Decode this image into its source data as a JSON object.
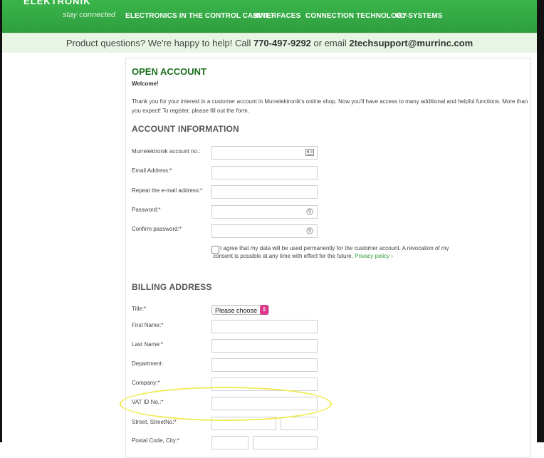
{
  "brand": {
    "name": "ELEKTRONIK",
    "tagline": "stay connected"
  },
  "nav": [
    "ELECTRONICS IN THE CONTROL CABINET",
    "INTERFACES",
    "CONNECTION TECHNOLOGY",
    "I/O-SYSTEMS"
  ],
  "hotline": {
    "prefix": "Product questions? We're happy to help! Call ",
    "phone": "770-497-9292",
    "mid": " or email ",
    "email": "2techsupport@murrinc.com"
  },
  "form": {
    "title": "OPEN ACCOUNT",
    "welcome": "Welcome!",
    "intro": "Thank you for your interest in a customer account in Murrelektronik's online shop. Now you'll have access to many additional and helpful functions. More than you expect! To register, please fill out the form.",
    "account_section": "ACCOUNT INFORMATION",
    "account_fields": [
      "Murrelektronik account no.:",
      "Email Address:*",
      "Repeat the e-mail address:*",
      "Password:*",
      "Confirm password:*"
    ],
    "consent_text": "I agree that my data will be used permanently for the customer account. A revocation of my consent is possible at any time with effect for the future. ",
    "privacy_link": "Privacy policy ›",
    "billing_section": "BILLING ADDRESS",
    "billing_fields": [
      "Title:*",
      "First Name:*",
      "Last Name:*",
      "Department:",
      "Company:*",
      "VAT ID No.:*",
      "Street, StreetNo:*",
      "Postal Code, City:*"
    ],
    "title_select": "Please choose"
  },
  "colors": {
    "brand_green": "#39b54a",
    "heading_green": "#1a6e1a",
    "highlight": "#f2ea54",
    "select_accent": "#e0388f"
  }
}
